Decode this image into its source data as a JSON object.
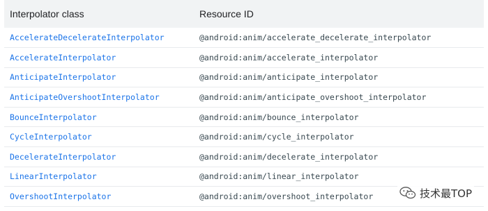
{
  "header": {
    "col1": "Interpolator class",
    "col2": "Resource ID"
  },
  "rows": [
    {
      "class": "AccelerateDecelerateInterpolator",
      "resource": "@android:anim/accelerate_decelerate_interpolator"
    },
    {
      "class": "AccelerateInterpolator",
      "resource": "@android:anim/accelerate_interpolator"
    },
    {
      "class": "AnticipateInterpolator",
      "resource": "@android:anim/anticipate_interpolator"
    },
    {
      "class": "AnticipateOvershootInterpolator",
      "resource": "@android:anim/anticipate_overshoot_interpolator"
    },
    {
      "class": "BounceInterpolator",
      "resource": "@android:anim/bounce_interpolator"
    },
    {
      "class": "CycleInterpolator",
      "resource": "@android:anim/cycle_interpolator"
    },
    {
      "class": "DecelerateInterpolator",
      "resource": "@android:anim/decelerate_interpolator"
    },
    {
      "class": "LinearInterpolator",
      "resource": "@android:anim/linear_interpolator"
    },
    {
      "class": "OvershootInterpolator",
      "resource": "@android:anim/overshoot_interpolator"
    }
  ],
  "watermark": {
    "icon": "wechat-icon",
    "text": "技术最TOP"
  },
  "colors": {
    "header_bg": "#f1f3f4",
    "link": "#1a73e8",
    "divider": "#e8eaed"
  }
}
